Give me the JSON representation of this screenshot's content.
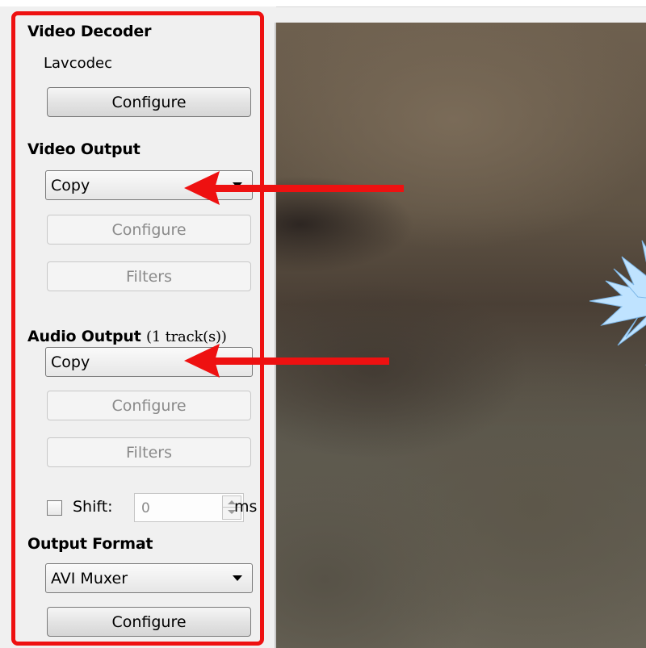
{
  "video_decoder": {
    "heading": "Video Decoder",
    "codec": "Lavcodec",
    "configure_label": "Configure"
  },
  "video_output": {
    "heading": "Video Output",
    "selected": "Copy",
    "configure_label": "Configure",
    "filters_label": "Filters"
  },
  "audio_output": {
    "heading": "Audio Output",
    "track_info": "(1 track(s))",
    "selected": "Copy",
    "configure_label": "Configure",
    "filters_label": "Filters",
    "shift_label": "Shift:",
    "shift_value": "0",
    "shift_unit": "ms"
  },
  "output_format": {
    "heading": "Output Format",
    "selected": "AVI Muxer",
    "configure_label": "Configure"
  },
  "colors": {
    "annotation_red": "#ee1111",
    "panel_bg": "#f0f0f0"
  }
}
